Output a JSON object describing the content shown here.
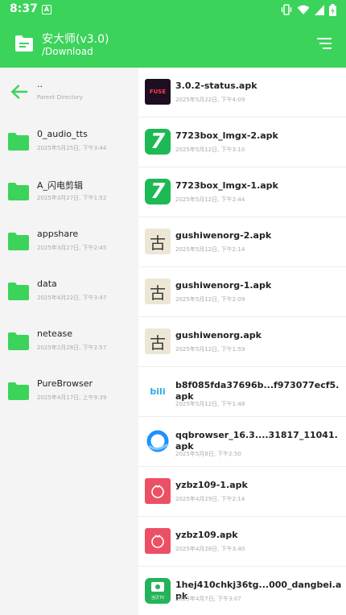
{
  "status_bar": {
    "time": "8:37",
    "notif_icon": "A"
  },
  "app_bar": {
    "title": "安大师(v3.0)",
    "path": "/Download"
  },
  "left_pane": {
    "items": [
      {
        "name": "..",
        "sub": "Parent Directory",
        "icon": "back-arrow-icon"
      },
      {
        "name": "0_audio_tts",
        "sub": "2025年5月25日, 下午3:44",
        "icon": "folder-icon"
      },
      {
        "name": "A_闪电剪辑",
        "sub": "2025年3月27日, 下午1:52",
        "icon": "folder-icon"
      },
      {
        "name": "appshare",
        "sub": "2025年3月27日, 下午2:45",
        "icon": "folder-icon"
      },
      {
        "name": "data",
        "sub": "2025年4月22日, 下午3:47",
        "icon": "folder-icon"
      },
      {
        "name": "netease",
        "sub": "2025年2月28日, 下午2:57",
        "icon": "folder-icon"
      },
      {
        "name": "PureBrowser",
        "sub": "2025年4月17日, 上午9:39",
        "icon": "folder-icon"
      }
    ]
  },
  "right_pane": {
    "items": [
      {
        "name": "3.0.2-status.apk",
        "sub": "2025年5月22日, 下午4:09",
        "thumb": "fuse",
        "thumb_text": "FUSE"
      },
      {
        "name": "7723box_lmgx-2.apk",
        "sub": "2025年5月12日, 下午3:10",
        "thumb": "seven",
        "thumb_text": "7"
      },
      {
        "name": "7723box_lmgx-1.apk",
        "sub": "2025年5月12日, 下午2:44",
        "thumb": "seven",
        "thumb_text": "7"
      },
      {
        "name": "gushiwenorg-2.apk",
        "sub": "2025年5月12日, 下午2:14",
        "thumb": "gu",
        "thumb_text": "古"
      },
      {
        "name": "gushiwenorg-1.apk",
        "sub": "2025年5月12日, 下午2:09",
        "thumb": "gu",
        "thumb_text": "古"
      },
      {
        "name": "gushiwenorg.apk",
        "sub": "2025年5月12日, 下午1:59",
        "thumb": "gu",
        "thumb_text": "古"
      },
      {
        "name": "b8f085fda37696b...f973077ecf5.apk",
        "sub": "2025年5月12日, 下午1:48",
        "thumb": "bili",
        "thumb_text": "bili"
      },
      {
        "name": "qqbrowser_16.3....31817_11041.apk",
        "sub": "2025年5月8日, 下午2:50",
        "thumb": "qq",
        "thumb_text": ""
      },
      {
        "name": "yzbz109-1.apk",
        "sub": "2025年4月29日, 下午2:14",
        "thumb": "tomato",
        "thumb_text": ""
      },
      {
        "name": "yzbz109.apk",
        "sub": "2025年4月28日, 下午3:40",
        "thumb": "tomato",
        "thumb_text": ""
      },
      {
        "name": "1hej410chkj36tg...000_dangbei.apk",
        "sub": "2025年4月7日, 下午3:07",
        "thumb": "tv",
        "thumb_text": "当贝TV"
      }
    ]
  },
  "colors": {
    "accent": "#3bd35a",
    "left_bg": "#f4f4f4"
  }
}
